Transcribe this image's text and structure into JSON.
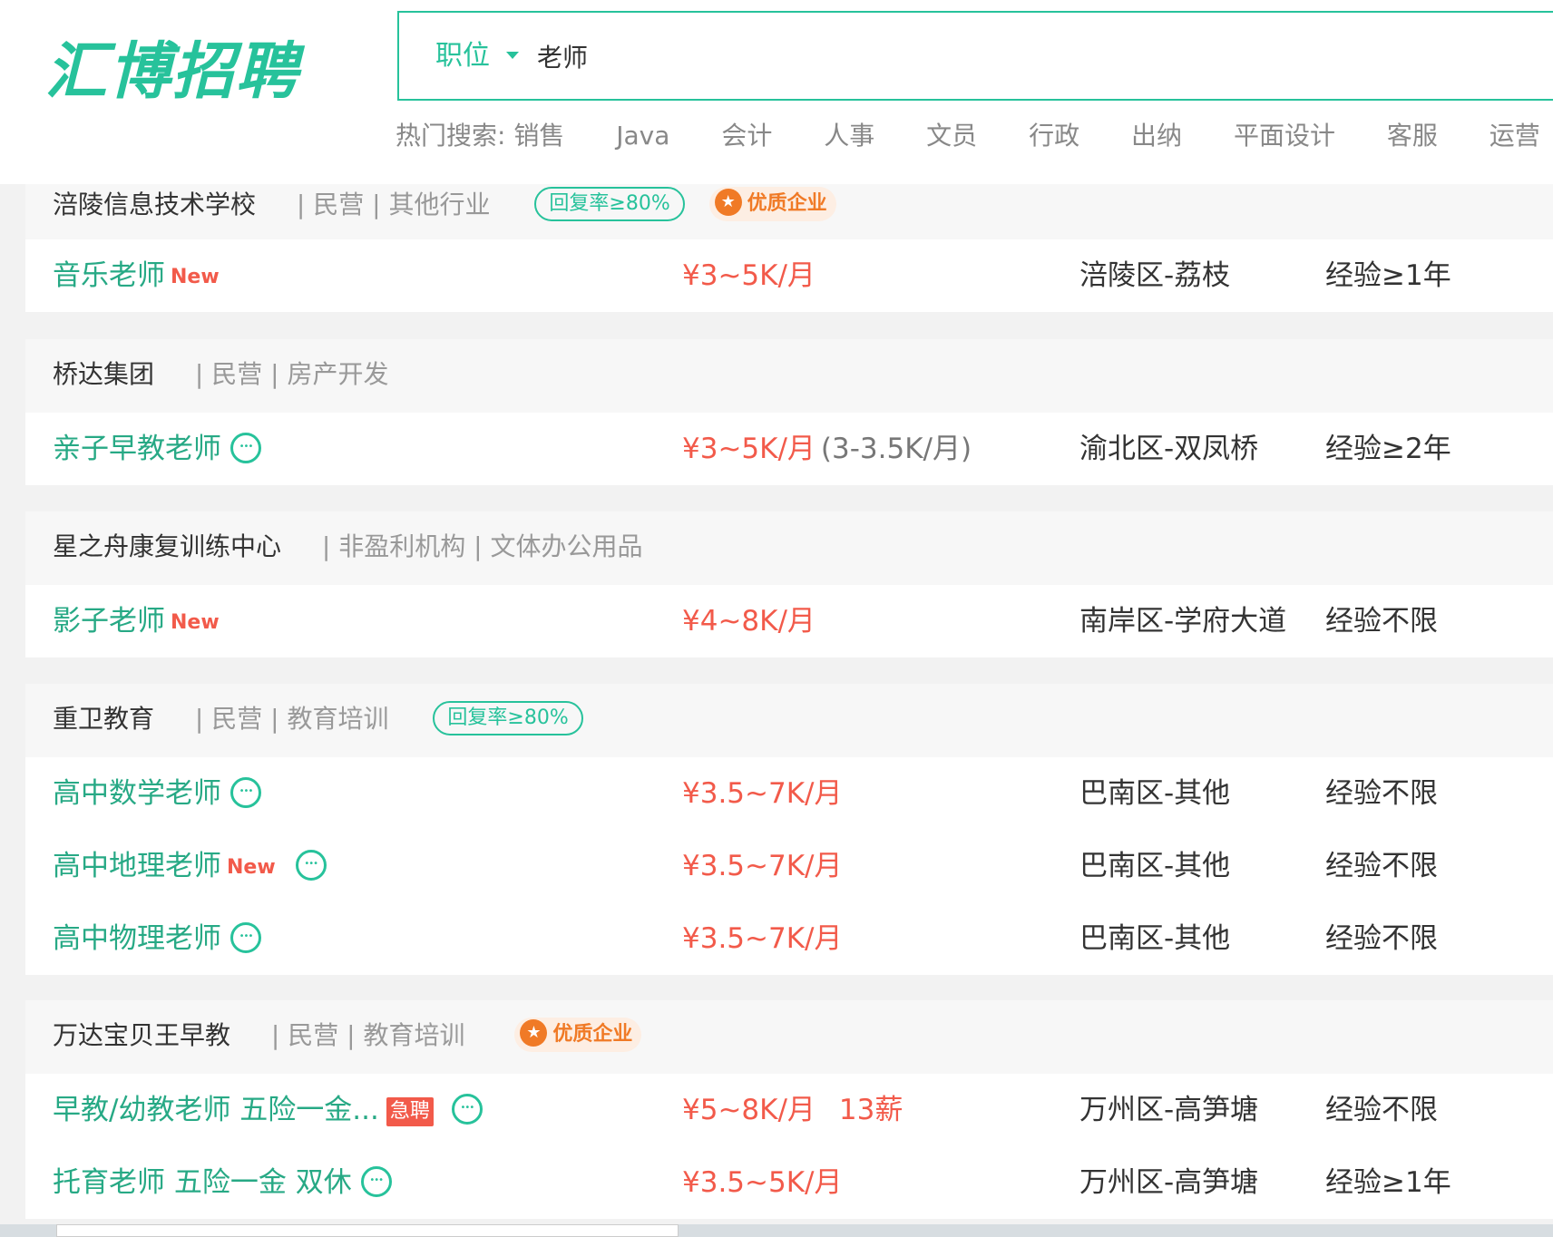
{
  "header": {
    "logo": "汇博招聘",
    "search": {
      "type_label": "职位",
      "query": "老师"
    },
    "hot_search": {
      "label": "热门搜索:",
      "items": [
        "销售",
        "Java",
        "会计",
        "人事",
        "文员",
        "行政",
        "出纳",
        "平面设计",
        "客服",
        "运营"
      ]
    }
  },
  "companies": [
    {
      "name": "涪陵信息技术学校",
      "meta": "| 民营 | 其他行业",
      "reply_badge": "回复率≥80%",
      "quality_badge": "优质企业",
      "jobs": [
        {
          "title": "音乐老师",
          "tag": "New",
          "salary": "¥3~5K/月",
          "location": "涪陵区-荔枝",
          "experience": "经验≥1年"
        }
      ]
    },
    {
      "name": "桥达集团",
      "meta": "| 民营 | 房产开发",
      "jobs": [
        {
          "title": "亲子早教老师",
          "salary": "¥3~5K/月",
          "salary_extra": "(3-3.5K/月)",
          "location": "渝北区-双凤桥",
          "experience": "经验≥2年"
        }
      ]
    },
    {
      "name": "星之舟康复训练中心",
      "meta": "| 非盈利机构 | 文体办公用品",
      "jobs": [
        {
          "title": "影子老师",
          "tag": "New",
          "salary": "¥4~8K/月",
          "location": "南岸区-学府大道",
          "experience": "经验不限"
        }
      ]
    },
    {
      "name": "重卫教育",
      "meta": "| 民营 | 教育培训",
      "reply_badge": "回复率≥80%",
      "jobs": [
        {
          "title": "高中数学老师",
          "salary": "¥3.5~7K/月",
          "location": "巴南区-其他",
          "experience": "经验不限"
        },
        {
          "title": "高中地理老师",
          "tag": "New",
          "salary": "¥3.5~7K/月",
          "location": "巴南区-其他",
          "experience": "经验不限"
        },
        {
          "title": "高中物理老师",
          "salary": "¥3.5~7K/月",
          "location": "巴南区-其他",
          "experience": "经验不限"
        }
      ]
    },
    {
      "name": "万达宝贝王早教",
      "meta": "| 民营 | 教育培训",
      "quality_badge": "优质企业",
      "jobs": [
        {
          "title": "早教/幼教老师 五险一金...",
          "urgent": "急聘",
          "salary": "¥5~8K/月",
          "salary_bonus": "13薪",
          "location": "万州区-高笋塘",
          "experience": "经验不限"
        },
        {
          "title": "托育老师 五险一金 双休",
          "salary": "¥3.5~5K/月",
          "location": "万州区-高笋塘",
          "experience": "经验≥1年"
        }
      ]
    }
  ],
  "colors": {
    "brand": "#27c29b",
    "salary": "#f25a4a",
    "quality_badge": "#f07a26"
  }
}
